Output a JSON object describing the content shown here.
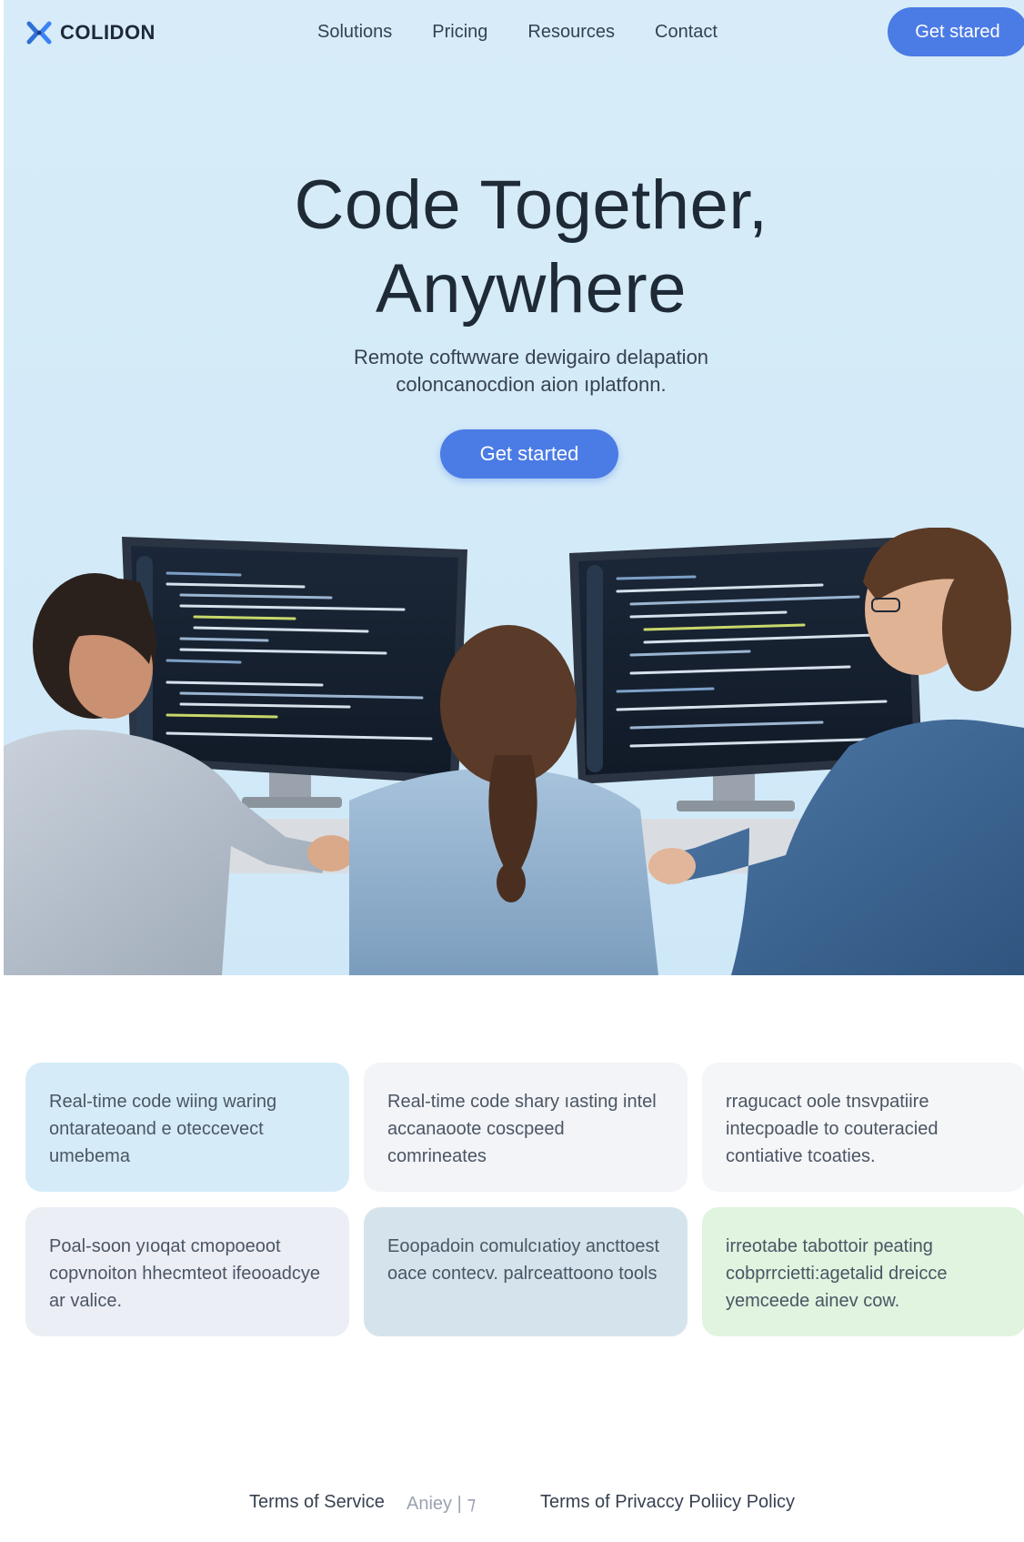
{
  "colors": {
    "hero_bg": "#d7ecf8",
    "accent": "#4b7be5",
    "text_dark": "#1f2a37"
  },
  "nav": {
    "logo_icon": "x-logo-icon",
    "logo_text": "COLIDON",
    "links": [
      "Solutions",
      "Pricing",
      "Resources",
      "Contact"
    ],
    "cta_label": "Get stared"
  },
  "hero": {
    "title_line1": "Code Together,",
    "title_line2": "Anywhere",
    "subtitle_line1": "Remote coftwware dewigairo delapation",
    "subtitle_line2": "coloncanocdion aion ıplatfonn.",
    "cta_label": "Get started",
    "image_alt": "three-developers-at-monitors-image"
  },
  "features": [
    {
      "text": "Real-time code wiing waring ontarateoand e oteccevect umebema"
    },
    {
      "text": "Real-time code shary ıasting intel accanaoote coscpeed comrineates"
    },
    {
      "text": "rragucact oole tnsvpatiire intecpoadle to couteracied contiative tcoaties."
    },
    {
      "text": "Poal-soon yıoqat cmopoeoot copvnoiton hhecmteot ifeooadcye ar valice."
    },
    {
      "text": "Eoopadoin comulcıatioy ancttoest oace contecv. palrceattoono tools"
    },
    {
      "text": "irreotabe tabottoir peating cobprrcietti:agetalid dreicce yemceede ainev cow."
    }
  ],
  "footer": {
    "terms": "Terms of Service",
    "muted": "Aniey | ⁊",
    "privacy": "Terms of Privaccy Poliicy Policy"
  }
}
